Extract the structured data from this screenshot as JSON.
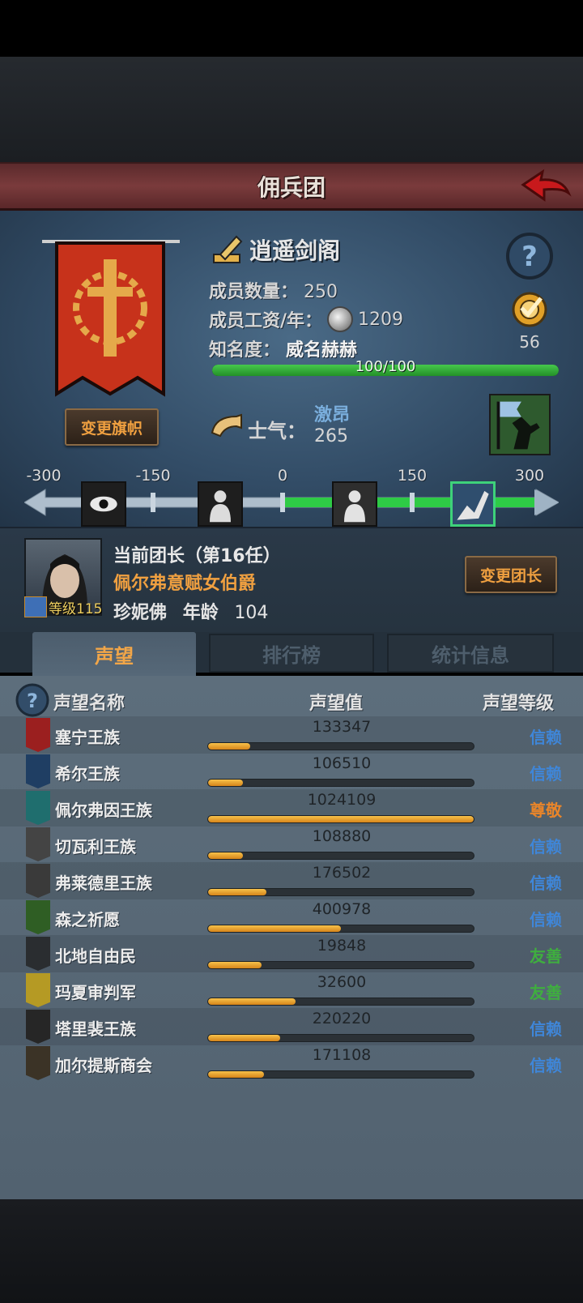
{
  "header": {
    "title": "佣兵团"
  },
  "guild": {
    "name": "逍遥剑阁",
    "member_count_label": "成员数量：",
    "member_count": "250",
    "wage_label": "成员工资/年：",
    "wage": "1209",
    "fame_label": "知名度：",
    "fame_value": "威名赫赫",
    "fame_progress_text": "100/100",
    "fame_progress": 1.0,
    "target_count": "56",
    "change_flag_label": "变更旗帜"
  },
  "morale": {
    "label": "士气：",
    "state": "激昂",
    "value": "265",
    "ticks": [
      "-300",
      "-150",
      "0",
      "150",
      "300"
    ],
    "current": 265
  },
  "leader": {
    "title": "当前团长（第16任）",
    "rank": "佩尔弗意赋女伯爵",
    "name": "珍妮佛",
    "age_label": "年龄",
    "age": "104",
    "level_text": "等级115",
    "change_leader_label": "变更团长"
  },
  "tabs": [
    {
      "label": "声望"
    },
    {
      "label": "排行榜"
    },
    {
      "label": "统计信息"
    }
  ],
  "reputation": {
    "col_name": "声望名称",
    "col_value": "声望值",
    "col_level": "声望等级",
    "level_colors": {
      "信赖": "#3f86d8",
      "尊敬": "#e8852a",
      "友善": "#3fae3f"
    },
    "rows": [
      {
        "name": "塞宁王族",
        "value": "133347",
        "fill": 0.16,
        "level": "信赖",
        "icon_color": "#9b1f1f"
      },
      {
        "name": "希尔王族",
        "value": "106510",
        "fill": 0.13,
        "level": "信赖",
        "icon_color": "#1f3e63"
      },
      {
        "name": "佩尔弗因王族",
        "value": "1024109",
        "fill": 1.0,
        "level": "尊敬",
        "icon_color": "#1f6e6e"
      },
      {
        "name": "切瓦利王族",
        "value": "108880",
        "fill": 0.13,
        "level": "信赖",
        "icon_color": "#444444"
      },
      {
        "name": "弗莱德里王族",
        "value": "176502",
        "fill": 0.22,
        "level": "信赖",
        "icon_color": "#3a3a3a"
      },
      {
        "name": "森之祈愿",
        "value": "400978",
        "fill": 0.5,
        "level": "信赖",
        "icon_color": "#2f5e24"
      },
      {
        "name": "北地自由民",
        "value": "19848",
        "fill": 0.2,
        "level": "友善",
        "icon_color": "#2a2d30"
      },
      {
        "name": "玛夏审判军",
        "value": "32600",
        "fill": 0.33,
        "level": "友善",
        "icon_color": "#b59a24"
      },
      {
        "name": "塔里裴王族",
        "value": "220220",
        "fill": 0.27,
        "level": "信赖",
        "icon_color": "#262626"
      },
      {
        "name": "加尔提斯商会",
        "value": "171108",
        "fill": 0.21,
        "level": "信赖",
        "icon_color": "#3b3326"
      }
    ]
  }
}
